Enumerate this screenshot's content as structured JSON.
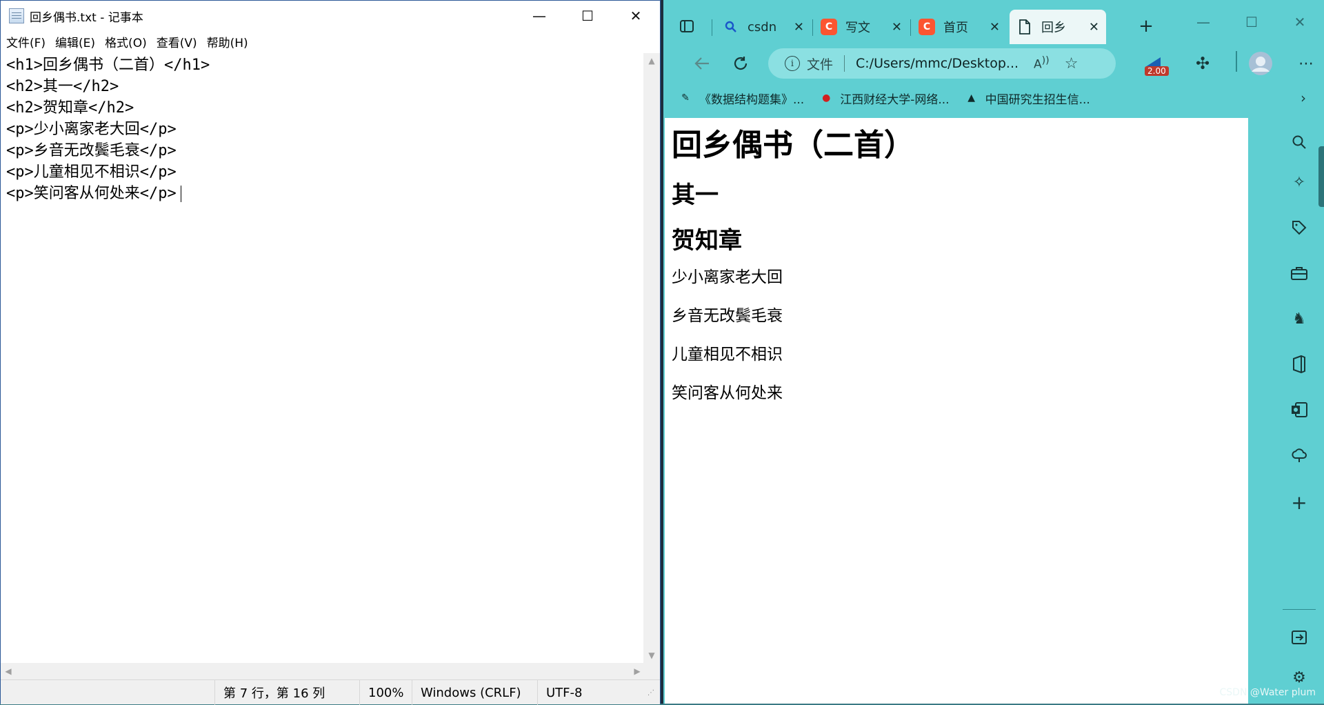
{
  "notepad": {
    "title": "回乡偶书.txt - 记事本",
    "caption": {
      "minimize": "—",
      "maximize": "☐",
      "close": "✕"
    },
    "menu": [
      "文件(F)",
      "编辑(E)",
      "格式(O)",
      "查看(V)",
      "帮助(H)"
    ],
    "lines": [
      "<h1>回乡偶书（二首）</h1>",
      "<h2>其一</h2>",
      "<h2>贺知章</h2>",
      "<p>少小离家老大回</p>",
      "<p>乡音无改鬓毛衰</p>",
      "<p>儿童相见不相识</p>",
      "<p>笑问客从何处来</p>"
    ],
    "status": {
      "position": "第 7 行，第 16 列",
      "zoom": "100%",
      "line_ending": "Windows (CRLF)",
      "encoding": "UTF-8"
    }
  },
  "browser": {
    "tabs": [
      {
        "label": "csdn",
        "icon": "search-icon",
        "active": false
      },
      {
        "label": "写文",
        "icon": "csdn-icon",
        "active": false
      },
      {
        "label": "首页",
        "icon": "csdn-icon",
        "active": false
      },
      {
        "label": "回乡",
        "icon": "file-icon",
        "active": true
      }
    ],
    "address": {
      "info_label": "文件",
      "url": "C:/Users/mmc/Desktop..."
    },
    "extension_badge": "2.00",
    "bookmarks": [
      {
        "label": "《数据结构题集》...",
        "icon": "book-icon"
      },
      {
        "label": "江西财经大学-网络...",
        "icon": "school-icon"
      },
      {
        "label": "中国研究生招生信...",
        "icon": "graduation-cap-icon"
      }
    ],
    "page": {
      "h1": "回乡偶书（二首）",
      "h2_1": "其一",
      "h2_2": "贺知章",
      "paragraphs": [
        "少小离家老大回",
        "乡音无改鬓毛衰",
        "儿童相见不相识",
        "笑问客从何处来"
      ]
    },
    "sidebar_icons": [
      "search-icon",
      "copilot-icon",
      "shopping-tag-icon",
      "tools-icon",
      "games-icon",
      "office-icon",
      "outlook-icon",
      "drop-icon",
      "add-icon",
      "exit-icon",
      "settings-icon"
    ]
  },
  "watermark": "CSDN @Water plum",
  "colors": {
    "edge_accent": "#5fcfd2",
    "csdn_red": "#fc5531"
  }
}
